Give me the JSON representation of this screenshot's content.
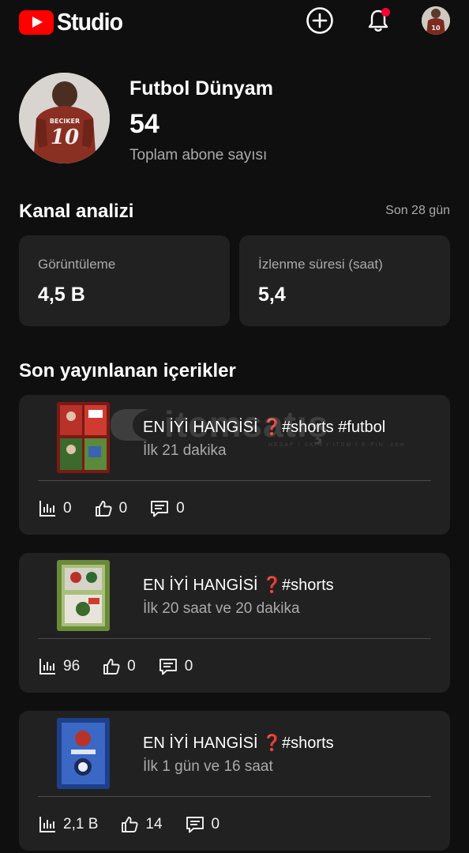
{
  "header": {
    "logo_text": "Studio",
    "create_icon": "create-plus-icon",
    "notifications_icon": "bell-icon",
    "account_icon": "account-avatar"
  },
  "channel": {
    "name": "Futbol Dünyam",
    "subscribers": "54",
    "subscribers_label": "Toplam abone sayısı"
  },
  "analytics": {
    "title": "Kanal analizi",
    "period": "Son 28 gün",
    "metrics": [
      {
        "label": "Görüntüleme",
        "value": "4,5 B"
      },
      {
        "label": "İzlenme süresi (saat)",
        "value": "5,4"
      }
    ]
  },
  "recent": {
    "title": "Son yayınlanan içerikler",
    "items": [
      {
        "title": "EN İYİ HANGİSİ ❓#shorts #futbol",
        "time": "İlk 21 dakika",
        "views": "0",
        "likes": "0",
        "comments": "0"
      },
      {
        "title": "EN İYİ HANGİSİ ❓#shorts",
        "time": "İlk 20 saat ve 20 dakika",
        "views": "96",
        "likes": "0",
        "comments": "0"
      },
      {
        "title": "EN İYİ HANGİSİ ❓#shorts",
        "time": "İlk 1 gün ve 16 saat",
        "views": "2,1 B",
        "likes": "14",
        "comments": "0"
      }
    ]
  },
  "watermark": {
    "text": "itemsatış",
    "sub": "HESAP / SKIN / ITEM / E-PIN .com"
  },
  "colors": {
    "background": "#0f0f0f",
    "card": "#212121",
    "brand_red": "#ff0000",
    "secondary_text": "#aaaaaa",
    "notification_dot": "#ff0033"
  }
}
